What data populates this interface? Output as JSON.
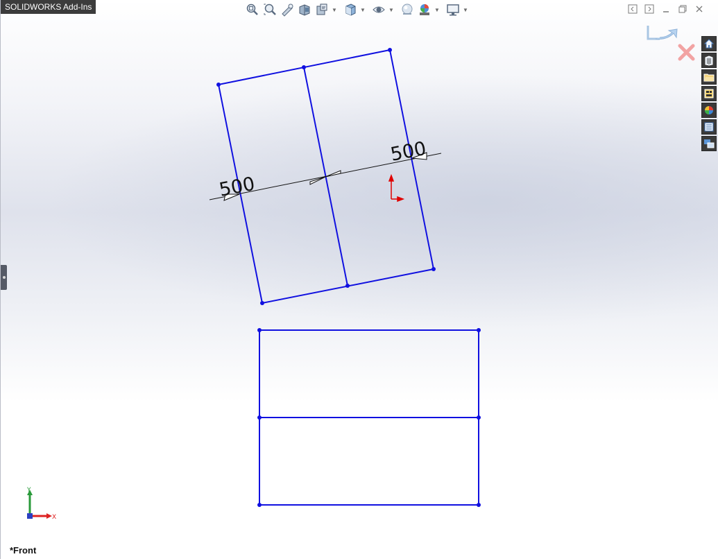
{
  "tab": {
    "title": "SOLIDWORKS Add-Ins"
  },
  "viewport": {
    "view_name": "*Front"
  },
  "dimensions": {
    "left": "500",
    "right": "500"
  },
  "triad": {
    "y_label": "Y",
    "x_label": "X"
  },
  "hud": {
    "icons": [
      "zoom-to-fit-icon",
      "zoom-to-area-icon",
      "previous-view-icon",
      "section-view-icon",
      "dynamic-annotation-icon",
      "view-orientation-icon",
      "display-style-icon",
      "hide-show-items-icon",
      "edit-appearance-icon",
      "apply-scene-icon",
      "view-settings-icon"
    ]
  },
  "taskpane": {
    "icons": [
      "home-icon",
      "design-library-icon",
      "file-explorer-icon",
      "view-palette-icon",
      "appearances-icon",
      "custom-properties-icon",
      "forum-icon"
    ]
  },
  "colors": {
    "sketch": "#1010e0",
    "origin": "#e00000",
    "dimension": "#111111"
  }
}
